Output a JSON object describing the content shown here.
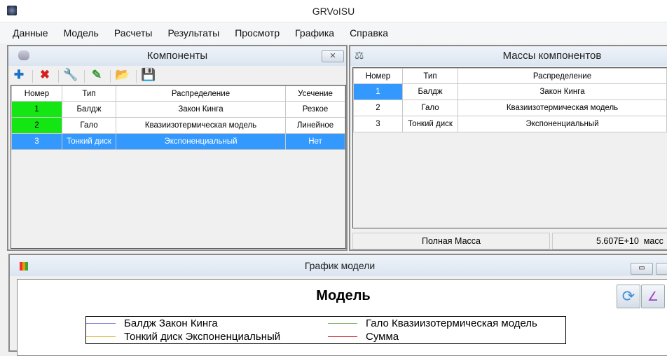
{
  "window": {
    "title": "GRVoISU"
  },
  "menu": [
    "Данные",
    "Модель",
    "Расчеты",
    "Результаты",
    "Просмотр",
    "Графика",
    "Справка"
  ],
  "components": {
    "title": "Компоненты",
    "toolbar": [
      {
        "icon": "add-icon",
        "glyph": "✚",
        "color": "#1a73c9"
      },
      {
        "icon": "delete-icon",
        "glyph": "✖",
        "color": "#d42020"
      },
      {
        "icon": "wrench-icon",
        "glyph": "🔧",
        "color": "#3a7fd0"
      },
      {
        "icon": "pencil-icon",
        "glyph": "✎",
        "color": "#3a9a3a"
      },
      {
        "icon": "open-folder-icon",
        "glyph": "📂",
        "color": "#d4a020"
      },
      {
        "icon": "save-icon",
        "glyph": "💾",
        "color": "#3040a0"
      }
    ],
    "columns": [
      "Номер",
      "Тип",
      "Распределение",
      "Усечение"
    ],
    "rows": [
      [
        "1",
        "Балдж",
        "Закон Кинга",
        "Резкое"
      ],
      [
        "2",
        "Гало",
        "Квазиизотермическая модель",
        "Линейное"
      ],
      [
        "3",
        "Тонкий диск",
        "Экспоненциальный",
        "Нет"
      ]
    ]
  },
  "masses": {
    "title": "Массы компонентов",
    "columns": [
      "Номер",
      "Тип",
      "Распределение"
    ],
    "rows": [
      [
        "1",
        "Балдж",
        "Закон Кинга"
      ],
      [
        "2",
        "Гало",
        "Квазиизотермическая модель"
      ],
      [
        "3",
        "Тонкий диск",
        "Экспоненциальный"
      ]
    ],
    "total_label": "Полная Масса",
    "total_value": "5.607E+10  масс"
  },
  "plot": {
    "window_title": "График модели",
    "chart_title": "Модель",
    "legend": [
      {
        "label": "Балдж  Закон Кинга",
        "color": "#8080e0"
      },
      {
        "label": "Гало  Квазиизотермическая модель",
        "color": "#80b060"
      },
      {
        "label": "Тонкий диск  Экспоненциальный",
        "color": "#d8b030"
      },
      {
        "label": "Сумма",
        "color": "#c01020"
      }
    ]
  }
}
